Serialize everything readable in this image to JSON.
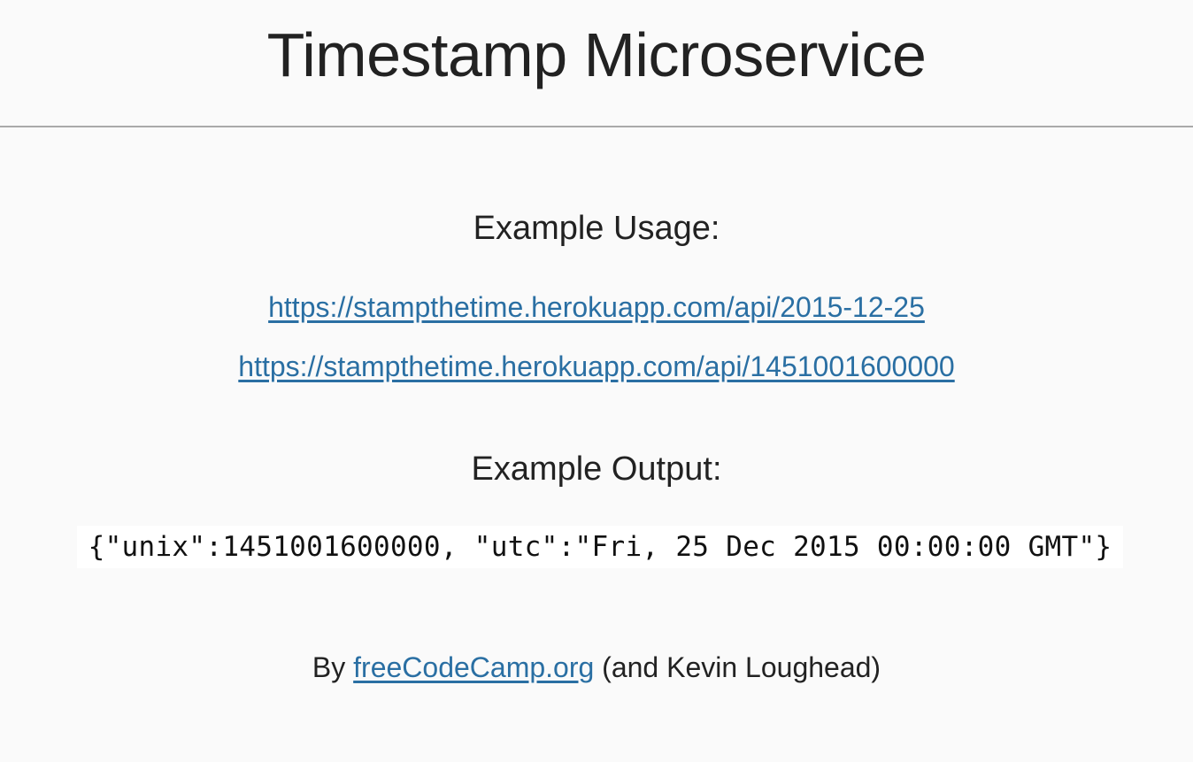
{
  "header": {
    "title": "Timestamp Microservice"
  },
  "usage": {
    "heading": "Example Usage:",
    "links": [
      "https://stampthetime.herokuapp.com/api/2015-12-25",
      "https://stampthetime.herokuapp.com/api/1451001600000"
    ]
  },
  "output": {
    "heading": "Example Output:",
    "code": "{\"unix\":1451001600000, \"utc\":\"Fri, 25 Dec 2015 00:00:00 GMT\"}"
  },
  "footer": {
    "prefix": "By ",
    "link_text": "freeCodeCamp.org",
    "suffix": " (and Kevin Loughead)"
  },
  "colors": {
    "background": "#fafafa",
    "link": "#2a6fa3",
    "text": "#222222",
    "rule": "#a9a9a9",
    "code_background": "#ffffff"
  }
}
